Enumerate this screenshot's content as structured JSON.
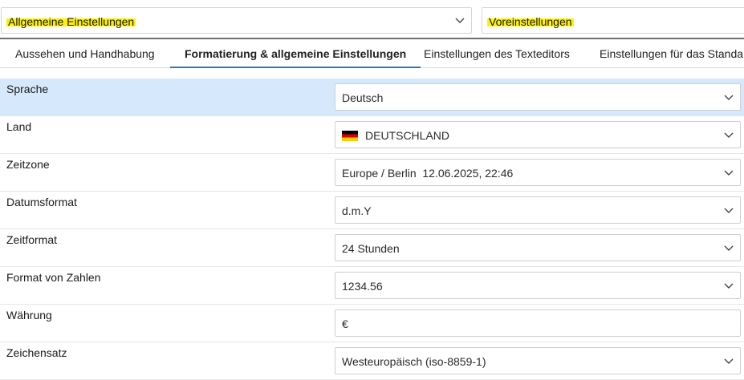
{
  "top": {
    "main_select": "Allgemeine Einstellungen",
    "presets_select": "Voreinstellungen"
  },
  "tabs": [
    {
      "label": "Aussehen und Handhabung"
    },
    {
      "label": "Formatierung & allgemeine Einstellungen",
      "active": true
    },
    {
      "label": "Einstellungen des Texteditors"
    },
    {
      "label": "Einstellungen für das Standa"
    }
  ],
  "rows": [
    {
      "label": "Sprache",
      "value": "Deutsch"
    },
    {
      "label": "Land",
      "value": "DEUTSCHLAND",
      "icon": "germany-flag-icon"
    },
    {
      "label": "Zeitzone",
      "value": "Europe / Berlin  12.06.2025, 22:46"
    },
    {
      "label": "Datumsformat",
      "value": "d.m.Y"
    },
    {
      "label": "Zeitformat",
      "value": "24 Stunden"
    },
    {
      "label": "Format von Zahlen",
      "value": "1234.56"
    },
    {
      "label": "Währung",
      "value": "€"
    },
    {
      "label": "Zeichensatz",
      "value": "Westeuropäisch (iso-8859-1)"
    }
  ],
  "colors": {
    "highlight": "#fff200",
    "selected_row": "#d6e8fb",
    "tab_underline": "#2b78c2"
  }
}
